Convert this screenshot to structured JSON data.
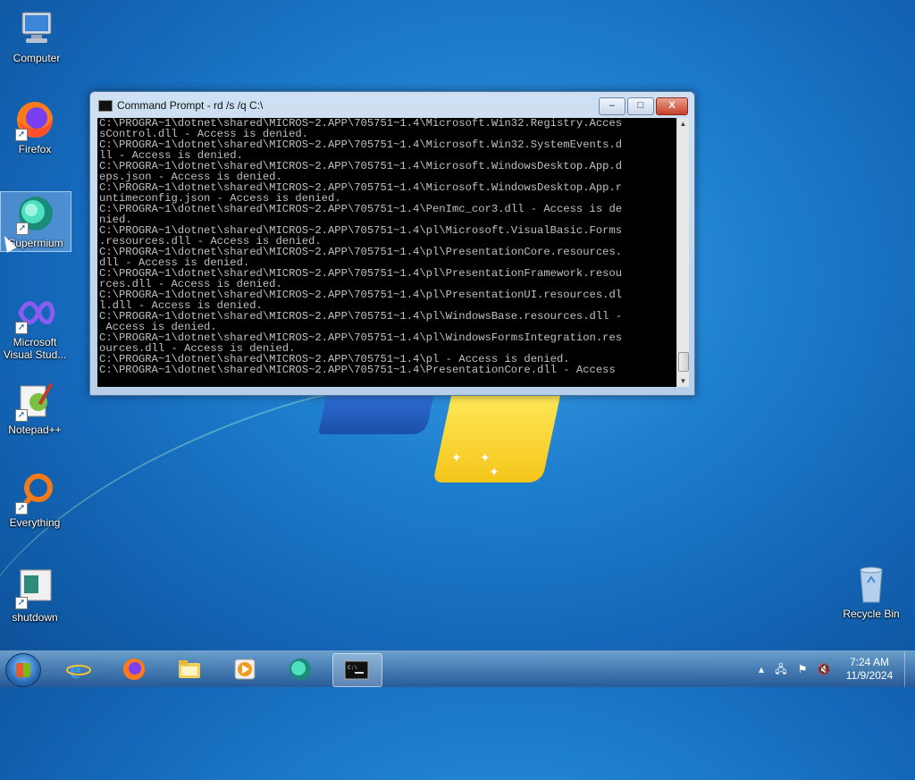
{
  "desktop": {
    "icons": [
      {
        "label": "Computer",
        "icon": "computer-icon"
      },
      {
        "label": "Firefox",
        "icon": "firefox-icon"
      },
      {
        "label": "Supermium",
        "icon": "supermium-icon"
      },
      {
        "label": "Microsoft\nVisual Stud...",
        "icon": "visual-studio-icon"
      },
      {
        "label": "Notepad++",
        "icon": "notepadpp-icon"
      },
      {
        "label": "Everything",
        "icon": "everything-icon"
      },
      {
        "label": "shutdown",
        "icon": "shutdown-icon"
      },
      {
        "label": "Recycle Bin",
        "icon": "recycle-bin-icon"
      }
    ]
  },
  "window": {
    "title": "Command Prompt - rd  /s /q C:\\",
    "min_label": "‒",
    "max_label": "□",
    "close_label": "X",
    "console_text": "C:\\PROGRA~1\\dotnet\\shared\\MICROS~2.APP\\705751~1.4\\Microsoft.Win32.Registry.Acces\nsControl.dll - Access is denied.\nC:\\PROGRA~1\\dotnet\\shared\\MICROS~2.APP\\705751~1.4\\Microsoft.Win32.SystemEvents.d\nll - Access is denied.\nC:\\PROGRA~1\\dotnet\\shared\\MICROS~2.APP\\705751~1.4\\Microsoft.WindowsDesktop.App.d\neps.json - Access is denied.\nC:\\PROGRA~1\\dotnet\\shared\\MICROS~2.APP\\705751~1.4\\Microsoft.WindowsDesktop.App.r\nuntimeconfig.json - Access is denied.\nC:\\PROGRA~1\\dotnet\\shared\\MICROS~2.APP\\705751~1.4\\PenImc_cor3.dll - Access is de\nnied.\nC:\\PROGRA~1\\dotnet\\shared\\MICROS~2.APP\\705751~1.4\\pl\\Microsoft.VisualBasic.Forms\n.resources.dll - Access is denied.\nC:\\PROGRA~1\\dotnet\\shared\\MICROS~2.APP\\705751~1.4\\pl\\PresentationCore.resources.\ndll - Access is denied.\nC:\\PROGRA~1\\dotnet\\shared\\MICROS~2.APP\\705751~1.4\\pl\\PresentationFramework.resou\nrces.dll - Access is denied.\nC:\\PROGRA~1\\dotnet\\shared\\MICROS~2.APP\\705751~1.4\\pl\\PresentationUI.resources.dl\nl.dll - Access is denied.\nC:\\PROGRA~1\\dotnet\\shared\\MICROS~2.APP\\705751~1.4\\pl\\WindowsBase.resources.dll -\n Access is denied.\nC:\\PROGRA~1\\dotnet\\shared\\MICROS~2.APP\\705751~1.4\\pl\\WindowsFormsIntegration.res\nources.dll - Access is denied.\nC:\\PROGRA~1\\dotnet\\shared\\MICROS~2.APP\\705751~1.4\\pl - Access is denied.\nC:\\PROGRA~1\\dotnet\\shared\\MICROS~2.APP\\705751~1.4\\PresentationCore.dll - Access"
  },
  "taskbar": {
    "items": [
      {
        "icon": "internet-explorer-icon"
      },
      {
        "icon": "firefox-icon"
      },
      {
        "icon": "file-explorer-icon"
      },
      {
        "icon": "media-player-icon"
      },
      {
        "icon": "supermium-icon"
      },
      {
        "icon": "command-prompt-icon",
        "active": true
      }
    ],
    "clock_time": "7:24 AM",
    "clock_date": "11/9/2024",
    "tray_icons": [
      "show-hidden-icons-icon",
      "network-icon",
      "action-center-flag-icon",
      "volume-muted-icon"
    ]
  },
  "colors": {
    "console_bg": "#000000",
    "console_fg": "#c0c0c0",
    "close_button": "#c8412a"
  }
}
